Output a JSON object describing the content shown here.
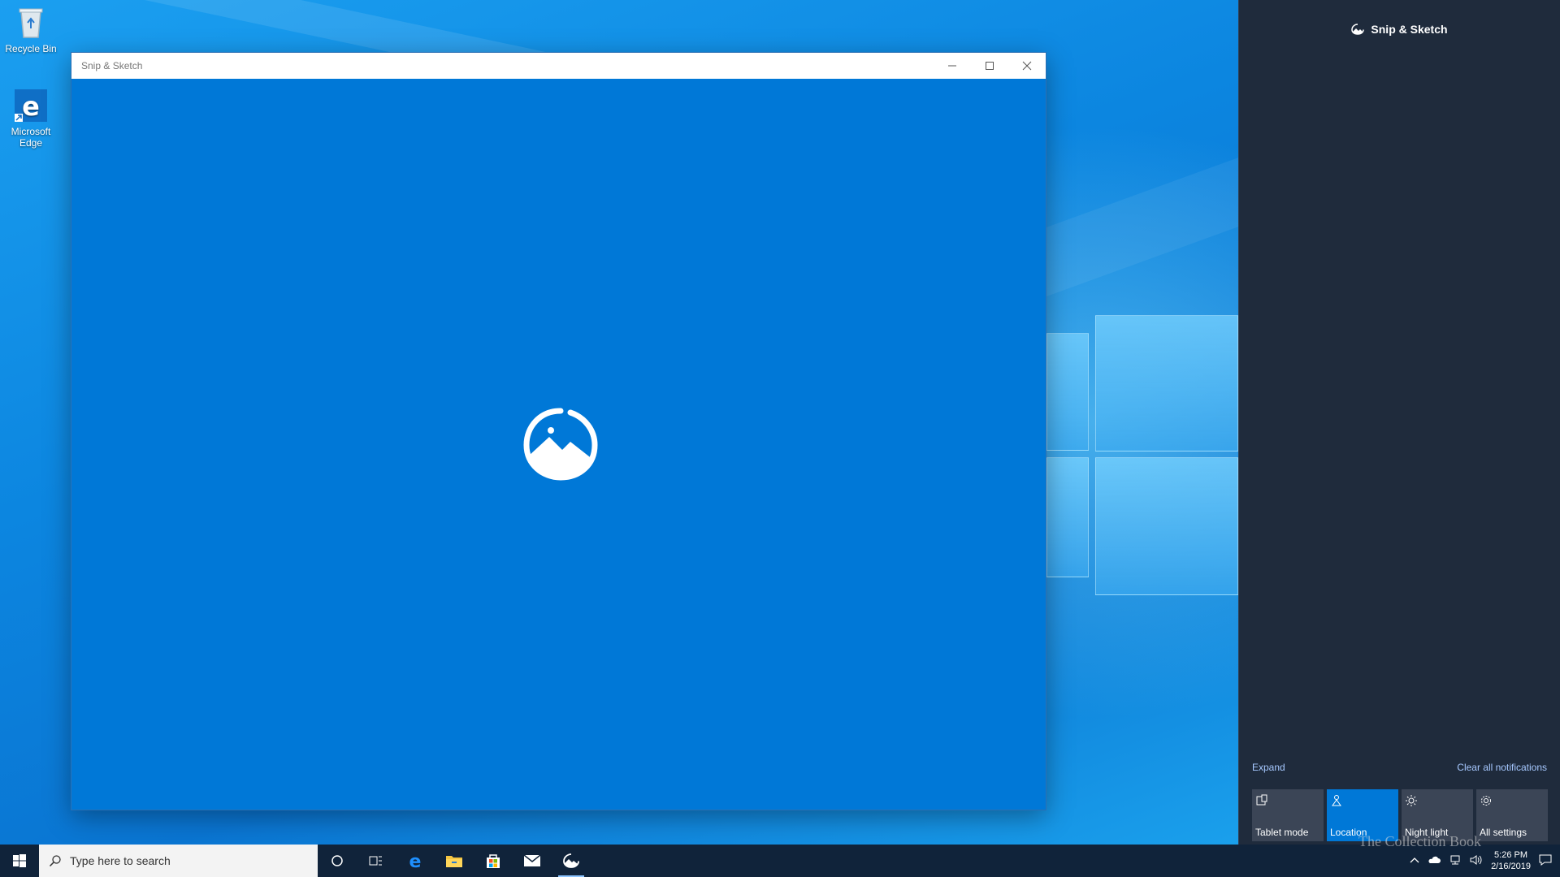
{
  "desktop": {
    "icons": [
      {
        "label": "Recycle Bin"
      },
      {
        "label": "Microsoft Edge"
      }
    ]
  },
  "window": {
    "title": "Snip & Sketch",
    "controls": {
      "minimize": "–",
      "maximize": "☐",
      "close": "✕"
    }
  },
  "action_center": {
    "header": "Snip & Sketch",
    "expand": "Expand",
    "clear_all": "Clear all notifications",
    "tiles": [
      {
        "label": "Tablet mode",
        "icon": "tablet-icon",
        "active": false
      },
      {
        "label": "Location",
        "icon": "location-icon",
        "active": true
      },
      {
        "label": "Night light",
        "icon": "night-light-icon",
        "active": false
      },
      {
        "label": "All settings",
        "icon": "gear-icon",
        "active": false
      }
    ]
  },
  "taskbar": {
    "search_placeholder": "Type here to search",
    "time": "5:26 PM",
    "date": "2/16/2019"
  },
  "watermark": "The Collection Book",
  "colors": {
    "accent": "#0078d7",
    "action_center_bg": "#1f2b3c",
    "taskbar_bg": "#10233a"
  }
}
